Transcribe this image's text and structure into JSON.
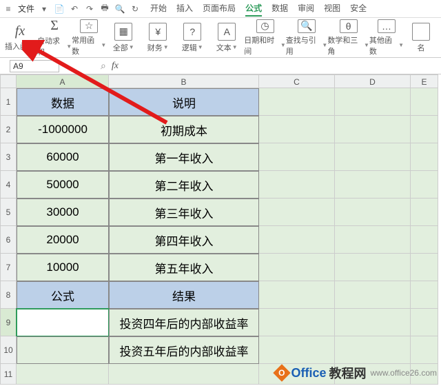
{
  "menubar": {
    "file": "文件",
    "tabs": [
      "开始",
      "插入",
      "页面布局",
      "公式",
      "数据",
      "审阅",
      "视图",
      "安全"
    ],
    "active_tab": 3
  },
  "ribbon": [
    {
      "icon": "fx",
      "label": "插入函数",
      "dd": false
    },
    {
      "icon": "Σ",
      "label": "自动求和",
      "dd": true
    },
    {
      "icon": "☆",
      "label": "常用函数",
      "dd": true
    },
    {
      "icon": "▦",
      "label": "全部",
      "dd": true
    },
    {
      "icon": "¥",
      "label": "财务",
      "dd": true
    },
    {
      "icon": "?",
      "label": "逻辑",
      "dd": true
    },
    {
      "icon": "A",
      "label": "文本",
      "dd": true
    },
    {
      "icon": "◷",
      "label": "日期和时间",
      "dd": true
    },
    {
      "icon": "🔍",
      "label": "查找与引用",
      "dd": true
    },
    {
      "icon": "θ",
      "label": "数学和三角",
      "dd": true
    },
    {
      "icon": "…",
      "label": "其他函数",
      "dd": true
    },
    {
      "icon": "",
      "label": "名",
      "dd": false
    }
  ],
  "namebox": "A9",
  "columns": [
    "A",
    "B",
    "C",
    "D",
    "E"
  ],
  "rows": [
    {
      "n": "1",
      "a": "数据",
      "b": "说明",
      "cls": "hdr"
    },
    {
      "n": "2",
      "a": "-1000000",
      "b": "初期成本",
      "cls": "box"
    },
    {
      "n": "3",
      "a": "60000",
      "b": "第一年收入",
      "cls": "box"
    },
    {
      "n": "4",
      "a": "50000",
      "b": "第二年收入",
      "cls": "box"
    },
    {
      "n": "5",
      "a": "30000",
      "b": "第三年收入",
      "cls": "box"
    },
    {
      "n": "6",
      "a": "20000",
      "b": "第四年收入",
      "cls": "box"
    },
    {
      "n": "7",
      "a": "10000",
      "b": "第五年收入",
      "cls": "box"
    },
    {
      "n": "8",
      "a": "公式",
      "b": "结果",
      "cls": "hdr"
    },
    {
      "n": "9",
      "a": "",
      "b": "投资四年后的内部收益率",
      "cls": "box",
      "sel": true
    },
    {
      "n": "10",
      "a": "",
      "b": "投资五年后的内部收益率",
      "cls": "box"
    },
    {
      "n": "11",
      "a": "",
      "b": "",
      "cls": ""
    }
  ],
  "watermark": {
    "brand": "Office",
    "suffix": "教程网",
    "url": "www.office26.com"
  },
  "chart_data": {
    "type": "table",
    "title": "",
    "columns": [
      "数据",
      "说明"
    ],
    "rows": [
      [
        -1000000,
        "初期成本"
      ],
      [
        60000,
        "第一年收入"
      ],
      [
        50000,
        "第二年收入"
      ],
      [
        30000,
        "第三年收入"
      ],
      [
        20000,
        "第四年收入"
      ],
      [
        10000,
        "第五年收入"
      ]
    ],
    "formula_section": {
      "header": [
        "公式",
        "结果"
      ],
      "rows": [
        [
          "",
          "投资四年后的内部收益率"
        ],
        [
          "",
          "投资五年后的内部收益率"
        ]
      ]
    }
  }
}
